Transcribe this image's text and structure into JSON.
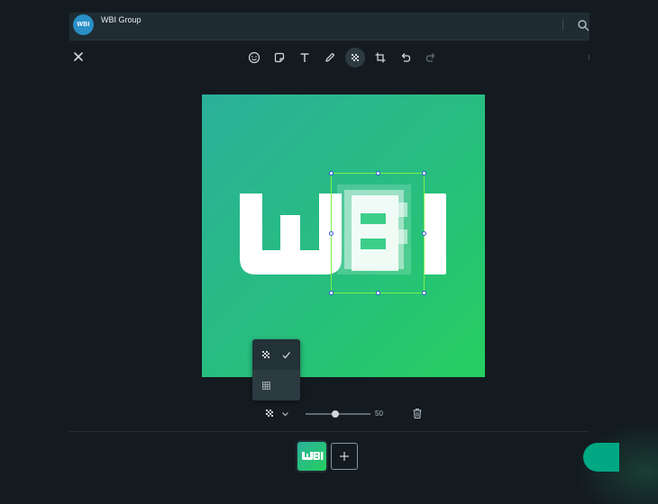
{
  "header": {
    "avatar_text": "WBI",
    "group_name": "WBI Group",
    "search_icon": "search-icon"
  },
  "toolbar": {
    "close_icon": "close-icon",
    "tools": [
      {
        "name": "emoji",
        "icon": "emoji-icon"
      },
      {
        "name": "sticker",
        "icon": "sticker-icon"
      },
      {
        "name": "text",
        "icon": "text-icon"
      },
      {
        "name": "draw",
        "icon": "pencil-icon"
      },
      {
        "name": "blur",
        "icon": "blur-icon",
        "active": true
      },
      {
        "name": "crop",
        "icon": "crop-icon"
      },
      {
        "name": "undo",
        "icon": "undo-icon"
      },
      {
        "name": "redo",
        "icon": "redo-icon"
      }
    ]
  },
  "image": {
    "logo_text": "WBI",
    "gradient_colors": [
      "#2bb09a",
      "#25cf60"
    ]
  },
  "blur_menu": {
    "items": [
      {
        "icon": "blur-pattern-icon",
        "selected": true
      },
      {
        "icon": "pixelate-grid-icon",
        "selected": false
      }
    ]
  },
  "blur_controls": {
    "strength": "50",
    "strength_fraction": 0.5
  },
  "footer": {
    "thumbnail_text": "WBI",
    "add_icon": "plus-icon",
    "send_color": "#00a884"
  },
  "colors": {
    "selection": "#7cf04a",
    "accent": "#00a884",
    "background": "#141b20"
  }
}
